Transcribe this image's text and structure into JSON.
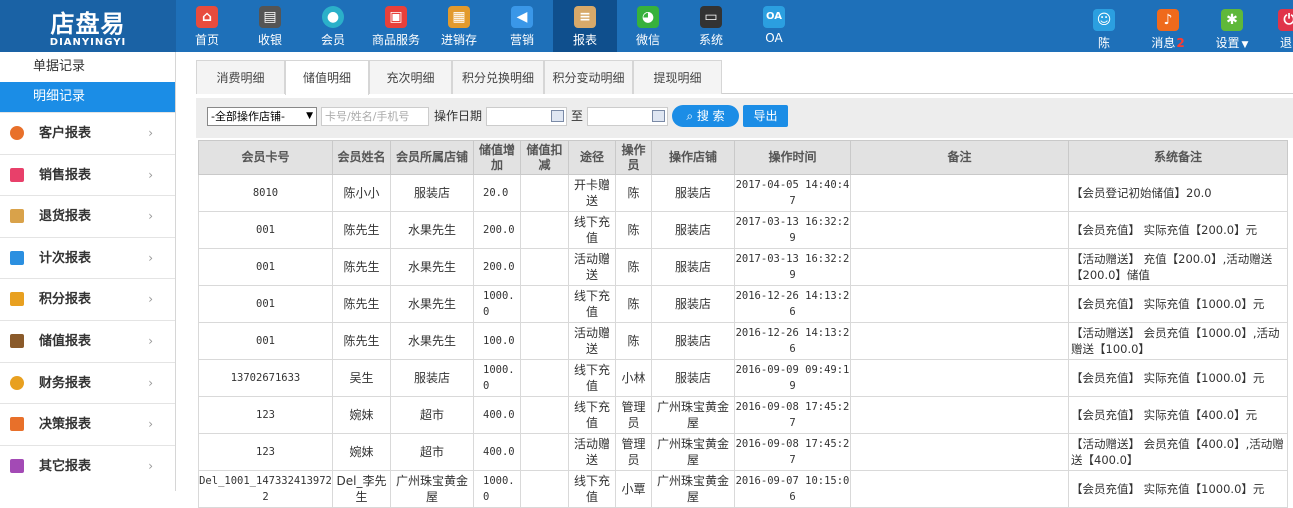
{
  "logo": {
    "cn": "店盘易",
    "en": "DIANYINGYI"
  },
  "nav": [
    {
      "label": "首页",
      "icon": "home-icon",
      "color": "#e84c3d"
    },
    {
      "label": "收银",
      "icon": "cash-register-icon",
      "color": "#555555"
    },
    {
      "label": "会员",
      "icon": "member-icon",
      "color": "#2bb0c9"
    },
    {
      "label": "商品服务",
      "icon": "goods-icon",
      "color": "#e8403a"
    },
    {
      "label": "进销存",
      "icon": "inventory-icon",
      "color": "#e29a2d"
    },
    {
      "label": "营销",
      "icon": "megaphone-icon",
      "color": "#3a97e8"
    },
    {
      "label": "报表",
      "icon": "report-icon",
      "color": "#d7a96a"
    },
    {
      "label": "微信",
      "icon": "wechat-icon",
      "color": "#37b13c"
    },
    {
      "label": "系统",
      "icon": "monitor-icon",
      "color": "#333333"
    },
    {
      "label": "OA",
      "icon": "oa-icon",
      "color": "#2b9fe0",
      "glyph": "OA"
    }
  ],
  "right_nav": {
    "user": {
      "label": "陈",
      "icon": "user-icon",
      "color": "#2b9fe0"
    },
    "messages": {
      "label": "消息",
      "count": "2",
      "icon": "bell-icon",
      "color": "#ef6a1c"
    },
    "settings": {
      "label": "设置",
      "icon": "gear-icon",
      "color": "#5fb83a"
    },
    "logout": {
      "label": "退",
      "icon": "power-icon",
      "color": "#e0344a"
    }
  },
  "sidebar": {
    "sub_items": [
      {
        "label": "单据记录"
      },
      {
        "label": "明细记录"
      }
    ],
    "menu": [
      {
        "label": "客户报表",
        "icon": "customer-icon",
        "color": "#e8702a"
      },
      {
        "label": "销售报表",
        "icon": "sales-report-icon",
        "color": "#e8406a"
      },
      {
        "label": "退货报表",
        "icon": "return-report-icon",
        "color": "#d9a24a"
      },
      {
        "label": "计次报表",
        "icon": "bar-chart-icon",
        "color": "#2b8fe0"
      },
      {
        "label": "积分报表",
        "icon": "points-tag-icon",
        "color": "#e8a020"
      },
      {
        "label": "储值报表",
        "icon": "wallet-icon",
        "color": "#8a5a2a"
      },
      {
        "label": "财务报表",
        "icon": "coin-icon",
        "color": "#e8a020"
      },
      {
        "label": "决策报表",
        "icon": "hand-icon",
        "color": "#e8702a"
      },
      {
        "label": "其它报表",
        "icon": "folder-icon",
        "color": "#a34ab5"
      }
    ]
  },
  "tabs": [
    "消费明细",
    "储值明细",
    "充次明细",
    "积分兑换明细",
    "积分变动明细",
    "提现明细"
  ],
  "filter": {
    "store_select": "-全部操作店铺-",
    "search_placeholder": "卡号/姓名/手机号",
    "date_label": "操作日期",
    "to_label": "至",
    "search_btn": "搜 索",
    "export_btn": "导出"
  },
  "table": {
    "columns": [
      "会员卡号",
      "会员姓名",
      "会员所属店铺",
      "储值增加",
      "储值扣减",
      "途径",
      "操作员",
      "操作店铺",
      "操作时间",
      "备注",
      "系统备注"
    ],
    "rows": [
      [
        "8010",
        "陈小小",
        "服装店",
        "20.0",
        "",
        "开卡赠送",
        "陈",
        "服装店",
        "2017-04-05 14:40:47",
        "",
        "【会员登记初始储值】20.0"
      ],
      [
        "001",
        "陈先生",
        "水果先生",
        "200.0",
        "",
        "线下充值",
        "陈",
        "服装店",
        "2017-03-13 16:32:29",
        "",
        "【会员充值】 实际充值【200.0】元"
      ],
      [
        "001",
        "陈先生",
        "水果先生",
        "200.0",
        "",
        "活动赠送",
        "陈",
        "服装店",
        "2017-03-13 16:32:29",
        "",
        "【活动赠送】 充值【200.0】,活动赠送【200.0】储值"
      ],
      [
        "001",
        "陈先生",
        "水果先生",
        "1000.0",
        "",
        "线下充值",
        "陈",
        "服装店",
        "2016-12-26 14:13:26",
        "",
        "【会员充值】 实际充值【1000.0】元"
      ],
      [
        "001",
        "陈先生",
        "水果先生",
        "100.0",
        "",
        "活动赠送",
        "陈",
        "服装店",
        "2016-12-26 14:13:26",
        "",
        "【活动赠送】 会员充值【1000.0】,活动赠送【100.0】"
      ],
      [
        "13702671633",
        "吴生",
        "服装店",
        "1000.0",
        "",
        "线下充值",
        "小林",
        "服装店",
        "2016-09-09 09:49:19",
        "",
        "【会员充值】 实际充值【1000.0】元"
      ],
      [
        "123",
        "婉妹",
        "超市",
        "400.0",
        "",
        "线下充值",
        "管理员",
        "广州珠宝黄金屋",
        "2016-09-08 17:45:27",
        "",
        "【会员充值】 实际充值【400.0】元"
      ],
      [
        "123",
        "婉妹",
        "超市",
        "400.0",
        "",
        "活动赠送",
        "管理员",
        "广州珠宝黄金屋",
        "2016-09-08 17:45:27",
        "",
        "【活动赠送】 会员充值【400.0】,活动赠送【400.0】"
      ],
      [
        "Del_1001_1473324139722",
        "Del_李先生",
        "广州珠宝黄金屋",
        "1000.0",
        "",
        "线下充值",
        "小覃",
        "广州珠宝黄金屋",
        "2016-09-07 10:15:06",
        "",
        "【会员充值】 实际充值【1000.0】元"
      ]
    ]
  }
}
